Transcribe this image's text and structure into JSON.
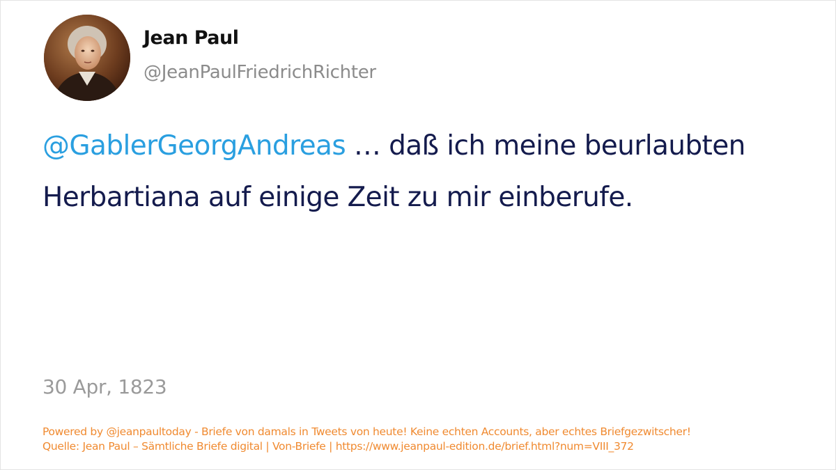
{
  "author": {
    "display_name": "Jean Paul",
    "handle": "@JeanPaulFriedrichRichter",
    "avatar_icon": "portrait-avatar"
  },
  "tweet": {
    "mention": "@GablerGeorgAndreas",
    "text": " … daß ich meine beurlaubten Herbartiana auf einige Zeit zu mir einberufe.",
    "date": "30 Apr, 1823"
  },
  "footer": {
    "line1": "Powered by @jeanpaultoday - Briefe von damals in Tweets von heute! Keine echten Accounts, aber echtes Briefgezwitscher!",
    "line2": "Quelle: Jean Paul – Sämtliche Briefe digital | Von-Briefe | https://www.jeanpaul-edition.de/brief.html?num=VIII_372"
  },
  "colors": {
    "mention": "#2a9fe0",
    "text": "#141b4d",
    "muted": "#8b8b8b",
    "footer": "#f08a30"
  }
}
